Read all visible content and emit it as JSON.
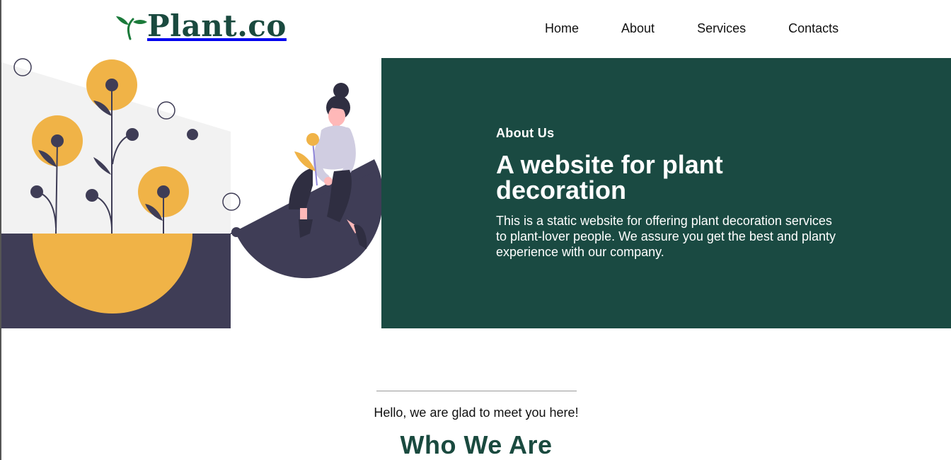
{
  "header": {
    "logo_text": "Plant.co",
    "nav": [
      {
        "label": "Home"
      },
      {
        "label": "About"
      },
      {
        "label": "Services"
      },
      {
        "label": "Contacts"
      }
    ]
  },
  "hero": {
    "kicker": "About Us",
    "title": "A website for plant decoration",
    "text": "This is a static website for offering plant decoration services to plant-lover people. We assure you get the best and planty experience with our company."
  },
  "who": {
    "greeting": "Hello, we are glad to meet you here!",
    "title": "Who We Are"
  },
  "colors": {
    "brand_green": "#1a4a42",
    "accent_yellow": "#f0b347",
    "dark_purple": "#3f3d56",
    "light_gray": "#f2f2f2"
  }
}
